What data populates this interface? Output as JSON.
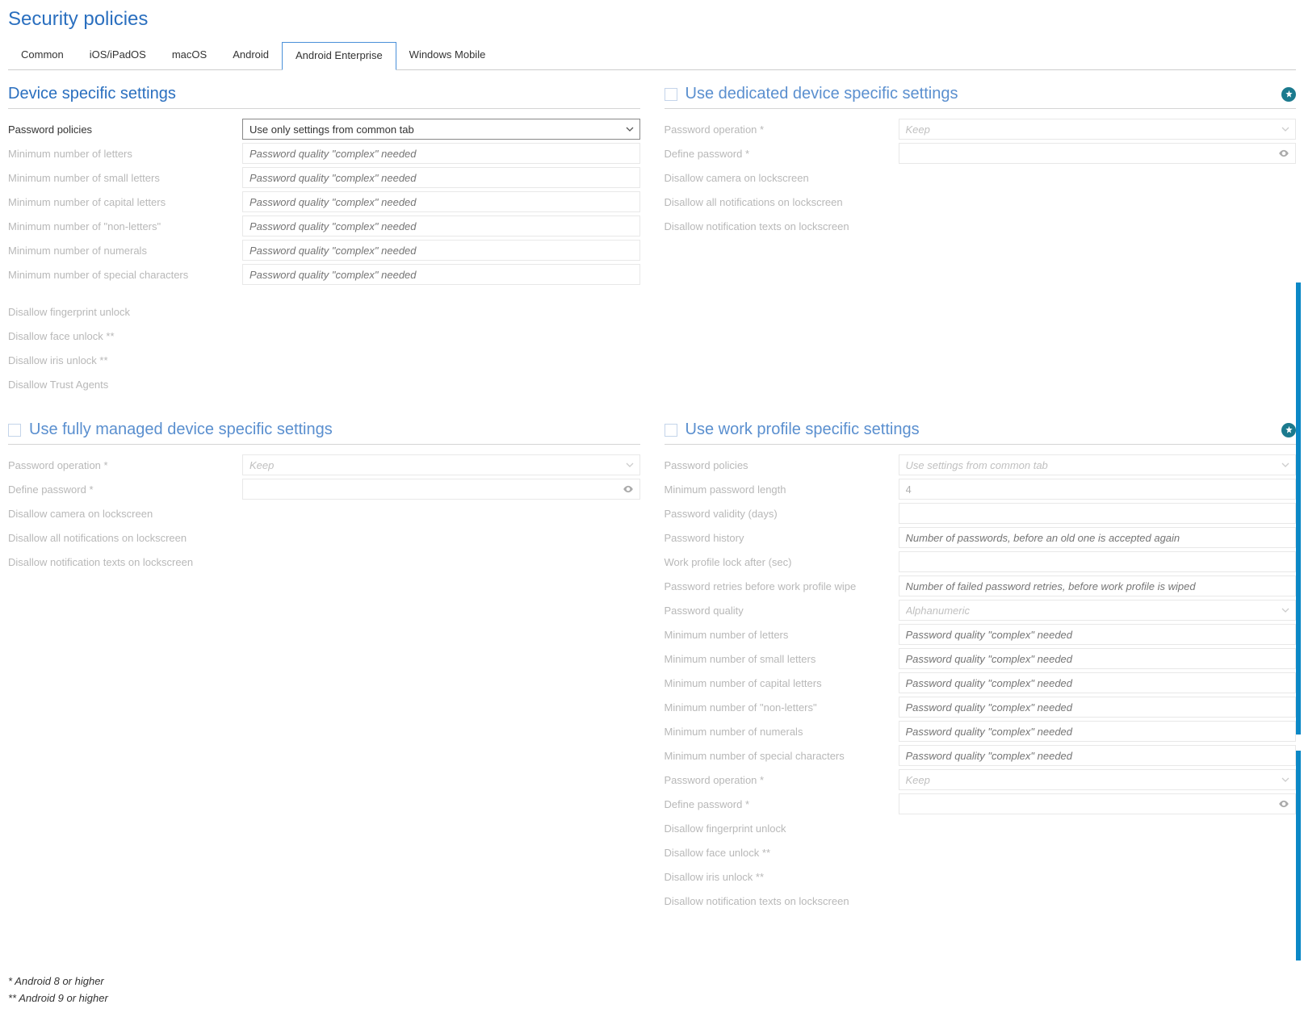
{
  "page_title": "Security policies",
  "tabs": [
    {
      "label": "Common",
      "active": false
    },
    {
      "label": "iOS/iPadOS",
      "active": false
    },
    {
      "label": "macOS",
      "active": false
    },
    {
      "label": "Android",
      "active": false
    },
    {
      "label": "Android Enterprise",
      "active": true
    },
    {
      "label": "Windows Mobile",
      "active": false
    }
  ],
  "complex_placeholder": "Password quality \"complex\" needed",
  "password_policies_options": [
    "Use only settings from common tab"
  ],
  "password_operation_default": "Keep",
  "password_quality_default": "Alphanumeric",
  "section_device_specific": {
    "title": "Device specific settings",
    "rows": [
      {
        "label": "Password policies",
        "type": "select",
        "value": "Use only settings from common tab",
        "active": true
      },
      {
        "label": "Minimum number of letters",
        "type": "text",
        "placeholder": "Password quality \"complex\" needed"
      },
      {
        "label": "Minimum number of small letters",
        "type": "text",
        "placeholder": "Password quality \"complex\" needed"
      },
      {
        "label": "Minimum number of capital letters",
        "type": "text",
        "placeholder": "Password quality \"complex\" needed"
      },
      {
        "label": "Minimum number of \"non-letters\"",
        "type": "text",
        "placeholder": "Password quality \"complex\" needed"
      },
      {
        "label": "Minimum number of numerals",
        "type": "text",
        "placeholder": "Password quality \"complex\" needed"
      },
      {
        "label": "Minimum number of special characters",
        "type": "text",
        "placeholder": "Password quality \"complex\" needed"
      }
    ],
    "plain": [
      "Disallow fingerprint unlock",
      "Disallow face unlock **",
      "Disallow iris unlock **",
      "Disallow Trust Agents"
    ]
  },
  "section_dedicated": {
    "title": "Use dedicated device specific settings",
    "rows": [
      {
        "label": "Password operation *",
        "type": "select",
        "value": "Keep"
      },
      {
        "label": "Define password *",
        "type": "password"
      }
    ],
    "plain": [
      "Disallow camera on lockscreen",
      "Disallow all notifications on lockscreen",
      "Disallow notification texts on lockscreen"
    ]
  },
  "section_fully_managed": {
    "title": "Use fully managed device specific settings",
    "rows": [
      {
        "label": "Password operation *",
        "type": "select",
        "value": "Keep"
      },
      {
        "label": "Define password *",
        "type": "password"
      }
    ],
    "plain": [
      "Disallow camera on lockscreen",
      "Disallow all notifications on lockscreen",
      "Disallow notification texts on lockscreen"
    ]
  },
  "section_work_profile": {
    "title": "Use work profile specific settings",
    "rows": [
      {
        "label": "Password policies",
        "type": "select",
        "value": "Use settings from common tab"
      },
      {
        "label": "Minimum password length",
        "type": "text",
        "value": "4"
      },
      {
        "label": "Password validity (days)",
        "type": "text",
        "value": ""
      },
      {
        "label": "Password history",
        "type": "text",
        "placeholder": "Number of passwords, before an old one is accepted again"
      },
      {
        "label": "Work profile lock after (sec)",
        "type": "text",
        "value": ""
      },
      {
        "label": "Password retries before work profile wipe",
        "type": "text",
        "placeholder": "Number of failed password retries, before work profile is wiped"
      },
      {
        "label": "Password quality",
        "type": "select",
        "value": "Alphanumeric"
      },
      {
        "label": "Minimum number of letters",
        "type": "text",
        "placeholder": "Password quality \"complex\" needed"
      },
      {
        "label": "Minimum number of small letters",
        "type": "text",
        "placeholder": "Password quality \"complex\" needed"
      },
      {
        "label": "Minimum number of capital letters",
        "type": "text",
        "placeholder": "Password quality \"complex\" needed"
      },
      {
        "label": "Minimum number of \"non-letters\"",
        "type": "text",
        "placeholder": "Password quality \"complex\" needed"
      },
      {
        "label": "Minimum number of numerals",
        "type": "text",
        "placeholder": "Password quality \"complex\" needed"
      },
      {
        "label": "Minimum number of special characters",
        "type": "text",
        "placeholder": "Password quality \"complex\" needed"
      },
      {
        "label": "Password operation *",
        "type": "select",
        "value": "Keep"
      },
      {
        "label": "Define password *",
        "type": "password"
      }
    ],
    "plain": [
      "Disallow fingerprint unlock",
      "Disallow face unlock **",
      "Disallow iris unlock **",
      "Disallow notification texts on lockscreen"
    ]
  },
  "footnotes": [
    "* Android 8 or higher",
    "** Android 9 or higher"
  ]
}
